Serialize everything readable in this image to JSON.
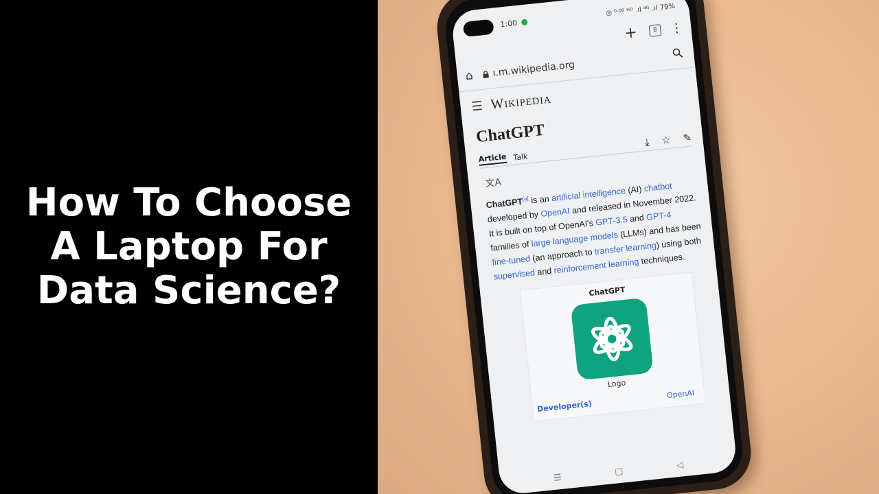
{
  "headline": {
    "lines": [
      "How To Choose",
      "A Laptop For",
      "Data Science?"
    ]
  },
  "phone": {
    "status": {
      "time": "1:00",
      "icons": "◎ ⁰·⁰⁰ ᴴᴰ .ıl ⁴ᴳ .ıl 79%"
    },
    "browser": {
      "url": "ı.m.wikipedia.org",
      "new_tab": "+",
      "tab_count": "8",
      "menu": "⋮"
    },
    "wiki": {
      "logo": "Wikipedia",
      "title": "ChatGPT",
      "tabs": [
        "Article",
        "Talk"
      ],
      "para": {
        "t1": "ChatGPT",
        "sup": "[a]",
        "t2": " is an ",
        "l1": "artificial intelligence",
        "t3": " (AI) ",
        "l2": "chatbot",
        "t4": " developed by ",
        "l3": "OpenAI",
        "t5": " and released in November 2022. It is built on top of OpenAI's ",
        "l4": "GPT-3.5",
        "t6": " and ",
        "l5": "GPT-4",
        "t7": " families of ",
        "l6": "large language models",
        "t8": " (LLMs) and has been ",
        "l7": "fine-tuned",
        "t9": " (an approach to ",
        "l8": "transfer learning",
        "t10": ") using both ",
        "l9": "supervised",
        "t11": " and ",
        "l10": "reinforcement learning",
        "t12": " techniques."
      },
      "infobox": {
        "title": "ChatGPT",
        "caption": "Logo",
        "row_label": "Developer(s)",
        "row_value": "OpenAI"
      }
    },
    "nav": [
      "☰",
      "▢",
      "◁"
    ]
  },
  "colors": {
    "background_left": "#000000",
    "headline": "#ffffff",
    "desk": "#eab98f",
    "phone_case": "#2b1f17",
    "wiki_link": "#3366cc",
    "chatgpt_logo": "#10a37f"
  }
}
